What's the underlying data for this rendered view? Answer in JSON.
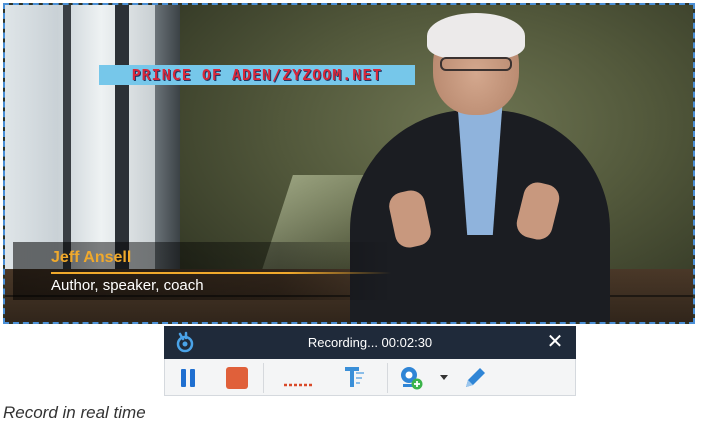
{
  "video": {
    "watermark": "PRINCE OF ADEN/ZYZOOM.NET",
    "lower_third": {
      "name": "Jeff Ansell",
      "title": "Author, speaker, coach"
    }
  },
  "recorder": {
    "status": "Recording... 00:02:30",
    "close_label": "✕",
    "tools": [
      "pause-icon",
      "stop-icon",
      "clip-length-icon",
      "pin-toolbar-icon",
      "webcam-add-icon",
      "dropdown-arrow-icon",
      "pen-icon"
    ]
  },
  "caption": "Record in real time",
  "colors": {
    "selection_border": "#4a8fd6",
    "toolbar_header": "#1f2a3a",
    "pause_blue": "#1f6fd0",
    "stop_orange": "#e0603a",
    "lower_third_gold": "#f0a92c"
  }
}
